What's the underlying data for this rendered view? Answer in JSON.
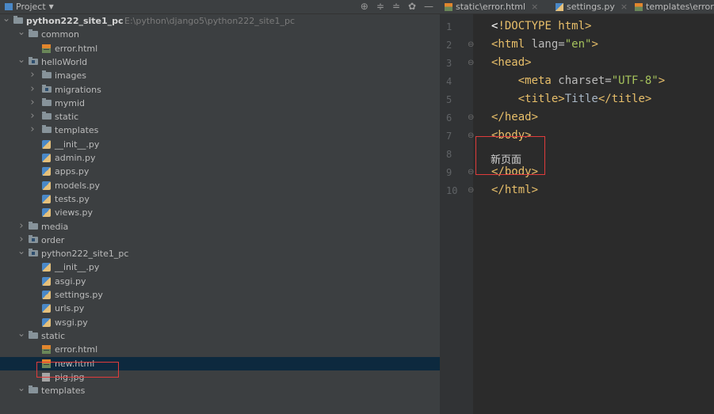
{
  "panel": {
    "title": "Project",
    "dropdown_icon": "chevron-down-icon",
    "header_icons": [
      "target-icon",
      "expand-icon",
      "collapse-icon",
      "gear-icon",
      "minimize-icon"
    ]
  },
  "tree": [
    {
      "label": "python222_site1_pc",
      "hint": "E:\\python\\django5\\python222_site1_pc",
      "type": "folder",
      "arrow": "v",
      "indent": 1,
      "bold": true
    },
    {
      "label": "common",
      "type": "folder",
      "arrow": "v",
      "indent": 2
    },
    {
      "label": "error.html",
      "type": "html",
      "indent": 3
    },
    {
      "label": "helloWorld",
      "type": "module",
      "arrow": "v",
      "indent": 2
    },
    {
      "label": "images",
      "type": "folder",
      "arrow": ">",
      "indent": 3
    },
    {
      "label": "migrations",
      "type": "module",
      "arrow": ">",
      "indent": 3
    },
    {
      "label": "mymid",
      "type": "folder",
      "arrow": ">",
      "indent": 3
    },
    {
      "label": "static",
      "type": "folder",
      "arrow": ">",
      "indent": 3
    },
    {
      "label": "templates",
      "type": "folder",
      "arrow": ">",
      "indent": 3
    },
    {
      "label": "__init__.py",
      "type": "py",
      "indent": 3
    },
    {
      "label": "admin.py",
      "type": "py",
      "indent": 3
    },
    {
      "label": "apps.py",
      "type": "py",
      "indent": 3
    },
    {
      "label": "models.py",
      "type": "py",
      "indent": 3
    },
    {
      "label": "tests.py",
      "type": "py",
      "indent": 3
    },
    {
      "label": "views.py",
      "type": "py",
      "indent": 3
    },
    {
      "label": "media",
      "type": "folder",
      "arrow": ">",
      "indent": 2
    },
    {
      "label": "order",
      "type": "module",
      "arrow": ">",
      "indent": 2
    },
    {
      "label": "python222_site1_pc",
      "type": "module",
      "arrow": "v",
      "indent": 2
    },
    {
      "label": "__init__.py",
      "type": "py",
      "indent": 3
    },
    {
      "label": "asgi.py",
      "type": "py",
      "indent": 3
    },
    {
      "label": "settings.py",
      "type": "py",
      "indent": 3
    },
    {
      "label": "urls.py",
      "type": "py",
      "indent": 3
    },
    {
      "label": "wsgi.py",
      "type": "py",
      "indent": 3
    },
    {
      "label": "static",
      "type": "folder",
      "arrow": "v",
      "indent": 2
    },
    {
      "label": "error.html",
      "type": "html",
      "indent": 3
    },
    {
      "label": "new.html",
      "type": "html",
      "indent": 3,
      "selected": true
    },
    {
      "label": "pig.jpg",
      "type": "img",
      "indent": 3
    },
    {
      "label": "templates",
      "type": "folder",
      "arrow": "v",
      "indent": 2
    }
  ],
  "tabs": [
    {
      "label": "static\\error.html",
      "close": "×"
    },
    {
      "label": "settings.py",
      "close": "×"
    },
    {
      "label": "templates\\error.",
      "close": ""
    }
  ],
  "editor": {
    "line_numbers": [
      "1",
      "2",
      "3",
      "4",
      "5",
      "6",
      "7",
      "8",
      "9",
      "10"
    ],
    "body_text": "新页面"
  },
  "colors": {
    "tag": "#e8bf6a",
    "string": "#a5c25c",
    "selection": "#0d293e",
    "highlight_box": "#e03c3c"
  }
}
